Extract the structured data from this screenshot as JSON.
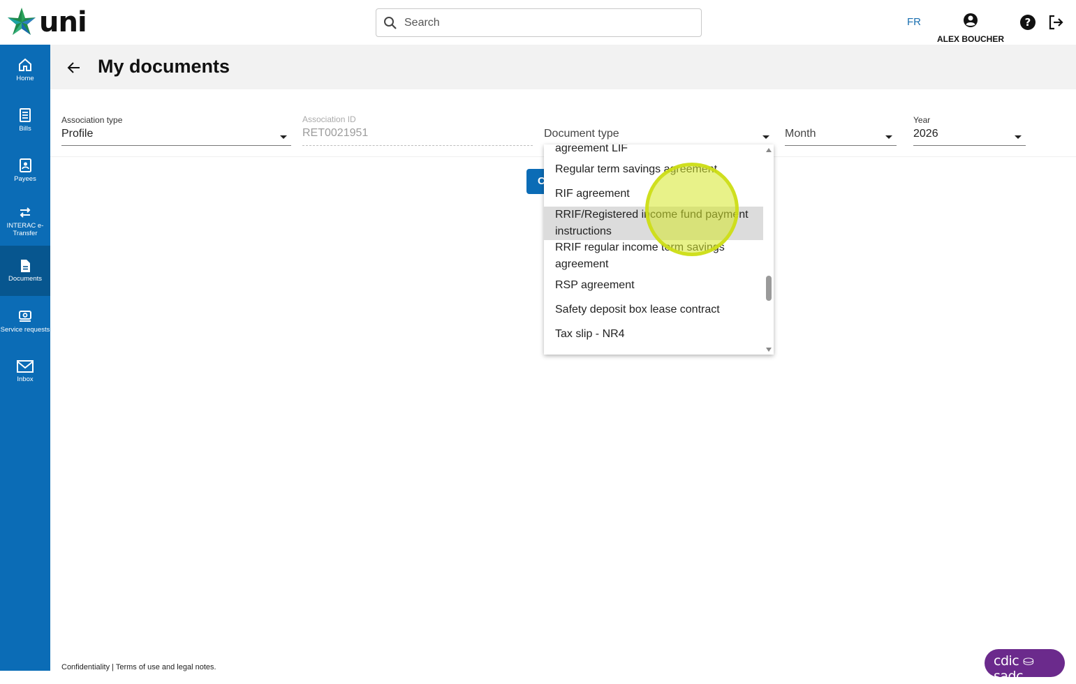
{
  "brand": {
    "name": "uni"
  },
  "search": {
    "placeholder": "Search"
  },
  "header": {
    "lang": "FR",
    "user_name": "ALEX BOUCHER"
  },
  "sidebar": {
    "items": [
      {
        "label": "Home",
        "icon": "home-icon"
      },
      {
        "label": "Bills",
        "icon": "bill-icon"
      },
      {
        "label": "Payees",
        "icon": "contacts-icon"
      },
      {
        "label": "INTERAC e-Transfer",
        "icon": "transfer-icon"
      },
      {
        "label": "Documents",
        "icon": "document-icon",
        "active": true
      },
      {
        "label": "Service requests",
        "icon": "service-icon"
      },
      {
        "label": "Inbox",
        "icon": "envelope-icon"
      }
    ]
  },
  "page": {
    "title": "My documents"
  },
  "filters": {
    "association_type": {
      "label": "Association type",
      "value": "Profile"
    },
    "association_id": {
      "label": "Association ID",
      "value": "RET0021951"
    },
    "document_type": {
      "label": "Document type"
    },
    "month": {
      "label": "Month"
    },
    "year": {
      "label": "Year",
      "value": "2026"
    }
  },
  "button": {
    "partial_label": "C"
  },
  "dropdown": {
    "items": [
      {
        "label": "agreement LIF"
      },
      {
        "label": "Regular term savings agreement"
      },
      {
        "label": "RIF agreement"
      },
      {
        "label": "RRIF/Registered income fund payment instructions",
        "highlighted": true
      },
      {
        "label": "RRIF regular income term savings agreement"
      },
      {
        "label": "RSP agreement"
      },
      {
        "label": "Safety deposit box lease contract"
      },
      {
        "label": "Tax slip - NR4"
      }
    ]
  },
  "footer": {
    "text": "Confidentiality | Terms of use and legal notes."
  },
  "badge": {
    "text": "cdic ⛀ sadc"
  },
  "colors": {
    "primary": "#0b6cb6",
    "sidebar_active": "#07568f",
    "cdic": "#6b2a8c",
    "cursor": "#d6e828"
  }
}
